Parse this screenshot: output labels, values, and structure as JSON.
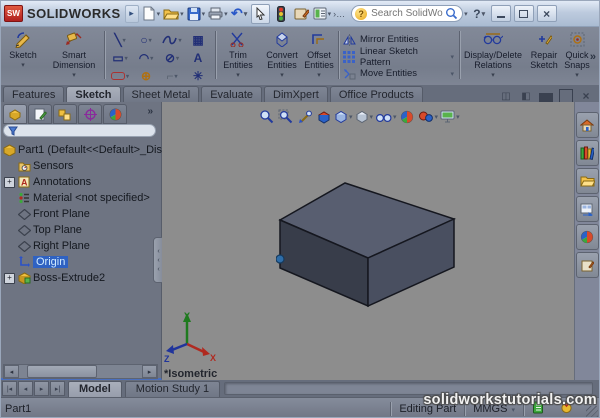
{
  "glyphs": {
    "caret": "▾",
    "chevron": "»",
    "grip_arrows": "‹\n‹\n‹",
    "left": "◂",
    "right": "▸",
    "first": "|◂",
    "last": "▸|",
    "close": "×",
    "undo": "↶",
    "help": "?",
    "ellipsis": "›…",
    "panel1": "◫",
    "panel2": "◧",
    "plus": "+",
    "line": "╲",
    "circle": "○",
    "rect": "▭",
    "arc": "◠",
    "ellipse": "⊘",
    "textA": "A",
    "pattern": "▦",
    "polygon": "⊕",
    "fillet": "⌐",
    "point": "✳"
  },
  "title_bar": {
    "logo": "SW",
    "app_name": "SOLIDWORKS",
    "search_placeholder": "Search SolidWo"
  },
  "ribbon": {
    "sketch": "Sketch",
    "smart_dimension": "Smart Dimension",
    "trim": "Trim Entities",
    "convert": "Convert Entities",
    "offset": "Offset Entities",
    "mirror": "Mirror Entities",
    "linear": "Linear Sketch Pattern",
    "move": "Move Entities",
    "display_delete": "Display/Delete Relations",
    "repair": "Repair Sketch",
    "quick_snaps": "Quick Snaps"
  },
  "ribbon_tabs": {
    "items": [
      "Features",
      "Sketch",
      "Sheet Metal",
      "Evaluate",
      "DimXpert",
      "Office Products"
    ],
    "active": "Sketch"
  },
  "feature_tree": {
    "root": "Part1 (Default<<Default>_Disp",
    "items": [
      "Sensors",
      "Annotations",
      "Material <not specified>",
      "Front Plane",
      "Top Plane",
      "Right Plane",
      "Origin",
      "Boss-Extrude2"
    ],
    "selected": "Origin"
  },
  "viewport": {
    "view_label": "*Isometric",
    "axes": {
      "x": "X",
      "y": "Y",
      "z": "Z"
    }
  },
  "model_tabs": {
    "items": [
      "Model",
      "Motion Study 1"
    ],
    "active": "Model"
  },
  "status_bar": {
    "document": "Part1",
    "mode": "Editing Part",
    "units": "MMGS",
    "watermark": "solidworkstutorials.com"
  },
  "colors": {
    "viewport_bg": "#8d8d8d",
    "box_top": "#585e70",
    "box_left": "#383d4a",
    "box_right": "#494f60",
    "box_edge": "#15171f",
    "origin_dot": "#2e6da8",
    "selection": "#2f62c2",
    "axis_x": "#b02a20",
    "axis_y": "#1e7a1e",
    "axis_z": "#20349c"
  }
}
